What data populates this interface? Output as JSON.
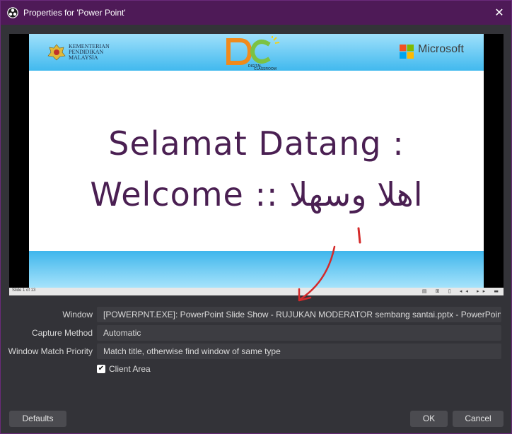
{
  "window": {
    "title": "Properties for 'Power Point'",
    "close_icon": "close-icon"
  },
  "slide": {
    "header_left_org": "KEMENTERIAN PENDIDIKAN MALAYSIA",
    "header_center_logo": "DIGITAL CLASSROOM",
    "header_right_brand": "Microsoft",
    "line1": "Selamat Datang :",
    "line2": "Welcome :: اهلا وسهلا",
    "status_left": "Slide 1 of 13",
    "status_right": "▤ ⊞ ▯ ◂◂ ▸▸ ▬"
  },
  "form": {
    "window_label": "Window",
    "window_value": "[POWERPNT.EXE]: PowerPoint Slide Show  -  RUJUKAN MODERATOR sembang santai.pptx - PowerPoint",
    "capture_label": "Capture Method",
    "capture_value": "Automatic",
    "match_label": "Window Match Priority",
    "match_value": "Match title, otherwise find window of same type",
    "client_area_label": "Client Area",
    "client_area_checked": true
  },
  "buttons": {
    "defaults": "Defaults",
    "ok": "OK",
    "cancel": "Cancel"
  },
  "colors": {
    "titlebar": "#4e1a57",
    "dialog_bg": "#333338",
    "slide_text": "#4a1f52",
    "annotation": "#d42a2a"
  }
}
